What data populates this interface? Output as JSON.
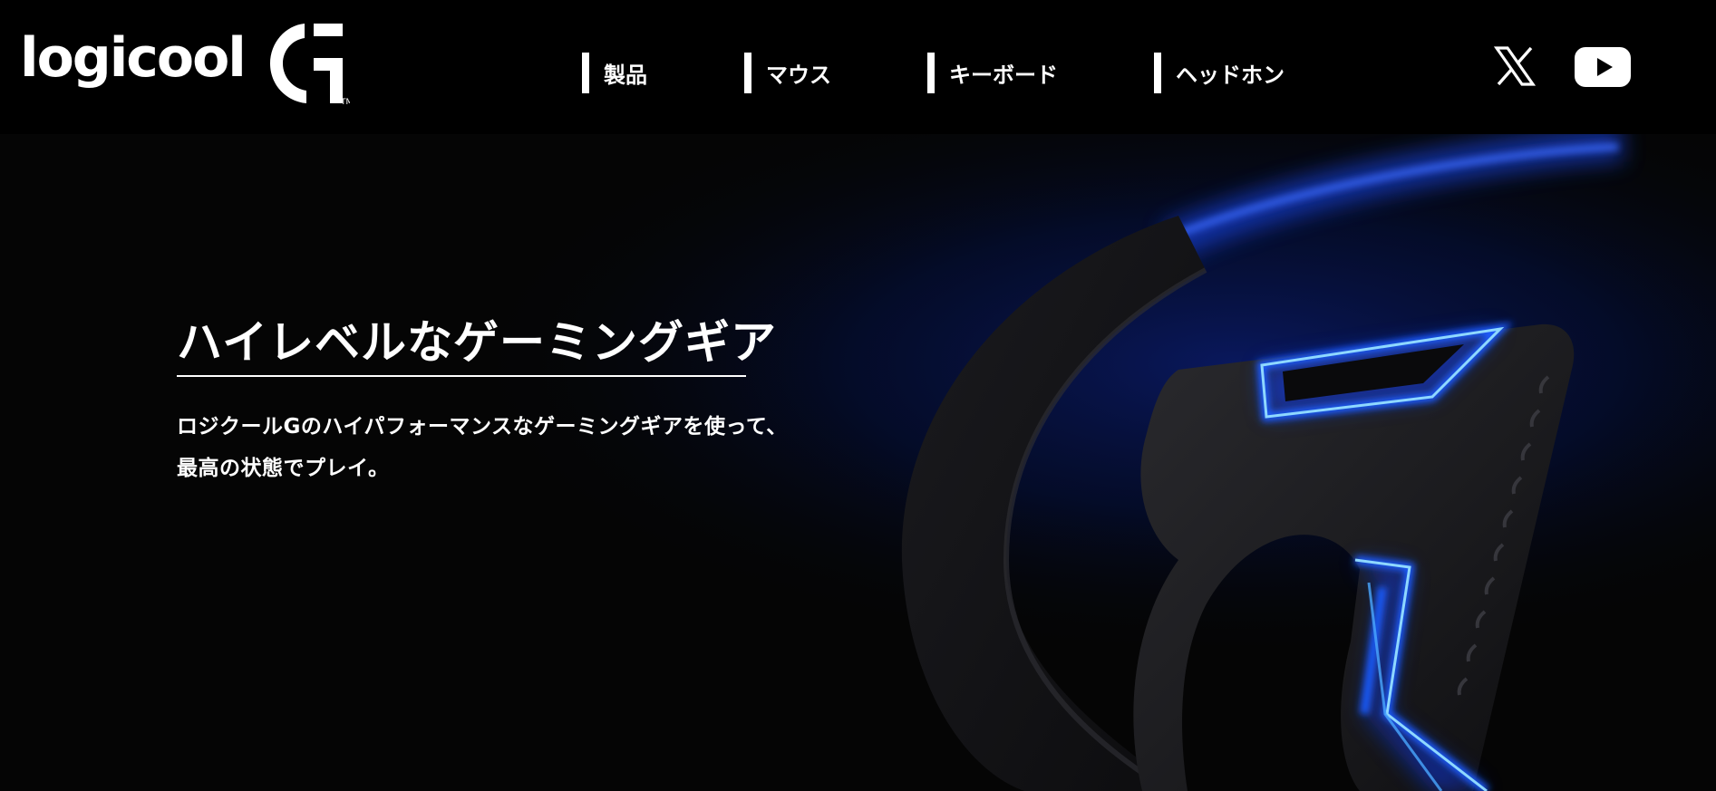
{
  "header": {
    "logo": {
      "wordmark": "logicool",
      "mark": "G",
      "trademark": "TM"
    },
    "nav": [
      {
        "label": "製品"
      },
      {
        "label": "マウス"
      },
      {
        "label": "キーボード"
      },
      {
        "label": "ヘッドホン"
      }
    ],
    "social": [
      {
        "icon": "x-icon"
      },
      {
        "icon": "youtube-icon"
      }
    ]
  },
  "hero": {
    "headline": "ハイレベルなゲーミングギア",
    "subline": [
      "ロジクールGのハイパフォーマンスなゲーミングギアを使って、",
      "最高の状態でプレイ。"
    ],
    "colors": {
      "glow": "#1a4dff",
      "glow_core": "#7fd0ff",
      "background": "#050505",
      "header": "#000000"
    }
  }
}
